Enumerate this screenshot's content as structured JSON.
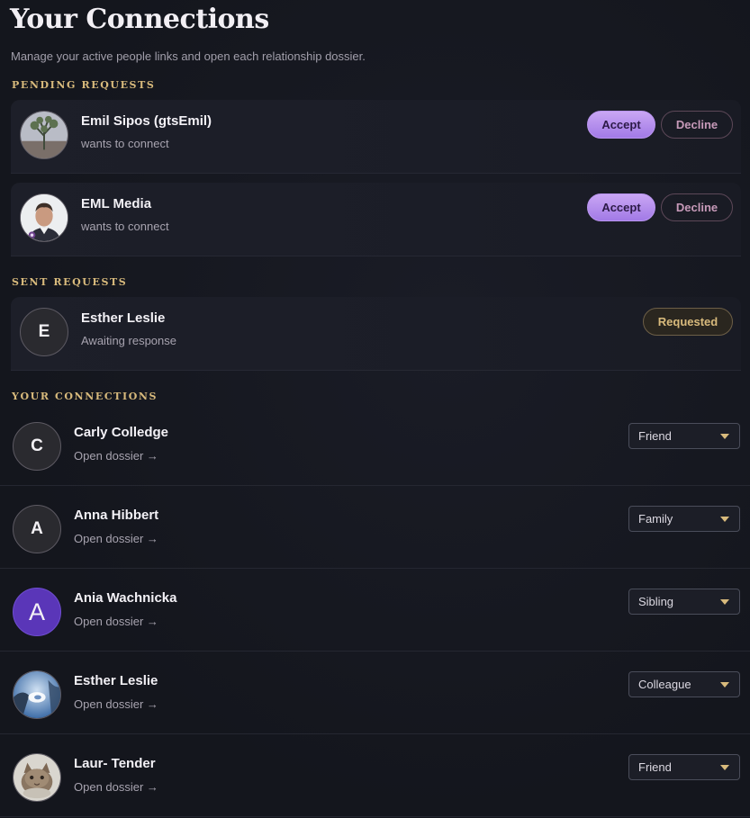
{
  "header": {
    "title": "Your Connections",
    "subtitle": "Manage your active people links and open each relationship dossier."
  },
  "pending": {
    "label": "PENDING REQUESTS",
    "items": [
      {
        "name": "Emil Sipos (gtsEmil)",
        "status": "wants to connect",
        "accept_label": "Accept",
        "decline_label": "Decline"
      },
      {
        "name": "EML Media",
        "status": "wants to connect",
        "accept_label": "Accept",
        "decline_label": "Decline"
      }
    ]
  },
  "sent": {
    "label": "SENT REQUESTS",
    "items": [
      {
        "initial": "E",
        "name": "Esther Leslie",
        "status": "Awaiting response",
        "button_label": "Requested"
      }
    ]
  },
  "connections": {
    "label": "YOUR CONNECTIONS",
    "items": [
      {
        "initial": "C",
        "name": "Carly Colledge",
        "link": "Open dossier →",
        "relationship": "Friend"
      },
      {
        "initial": "A",
        "name": "Anna Hibbert",
        "link": "Open dossier →",
        "relationship": "Family"
      },
      {
        "initial": "A",
        "name": "Ania Wachnicka",
        "link": "Open dossier →",
        "relationship": "Sibling"
      },
      {
        "name": "Esther Leslie",
        "link": "Open dossier →",
        "relationship": "Colleague"
      },
      {
        "name": "Laur- Tender",
        "link": "Open dossier →",
        "relationship": "Friend"
      }
    ]
  },
  "colors": {
    "background": "#14161d",
    "accent_gold": "#d8ba7c",
    "accept_purple": "#b894ee",
    "decline_pink": "#c79ab9",
    "avatar_purple": "#5a36b8"
  }
}
